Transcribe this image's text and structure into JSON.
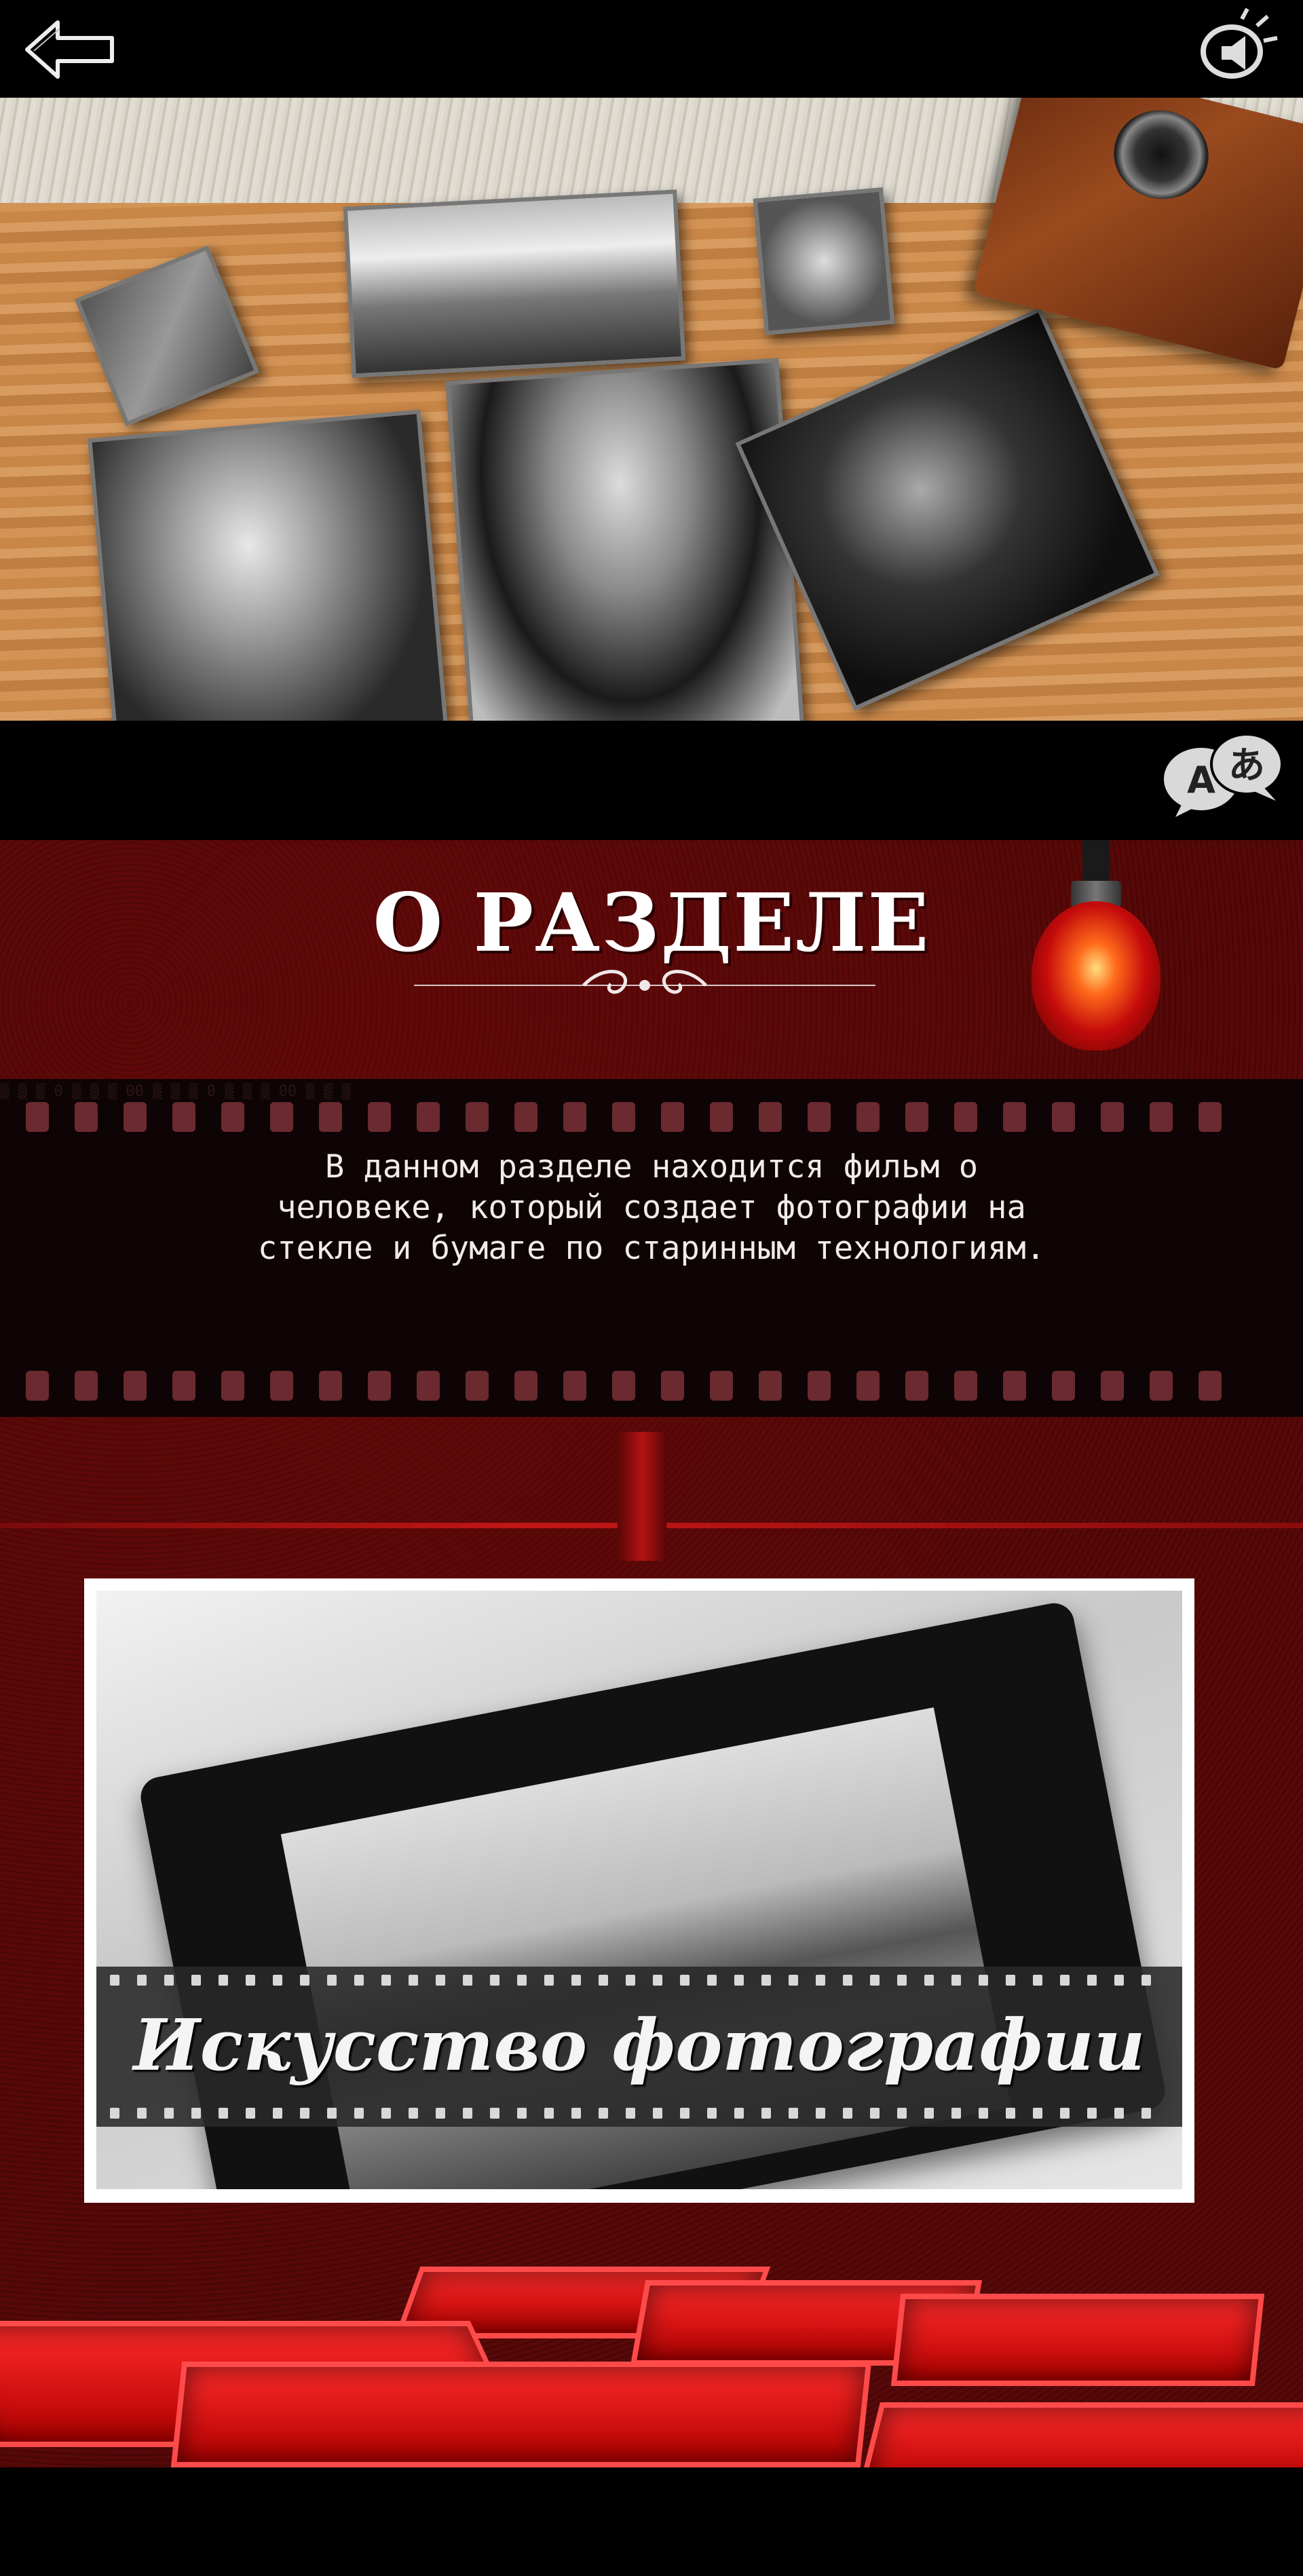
{
  "header": {
    "back_icon": "back-arrow-icon",
    "sound_icon": "sound-toggle-icon"
  },
  "hero": {
    "image": "tintype-photographs-on-table"
  },
  "language": {
    "icon": "translate-icon",
    "glyph_latin": "A",
    "glyph_japanese": "あ"
  },
  "about": {
    "title": "О РАЗДЕЛЕ",
    "description": "В данном разделе находится фильм о человеке, который создает фотографии на стекле и бумаге по старинным технологиям."
  },
  "video": {
    "title": "Искусство фотографии"
  },
  "colors": {
    "accent_red": "#c21616",
    "background_red": "#4c0707",
    "film_dark": "#0e0405"
  }
}
